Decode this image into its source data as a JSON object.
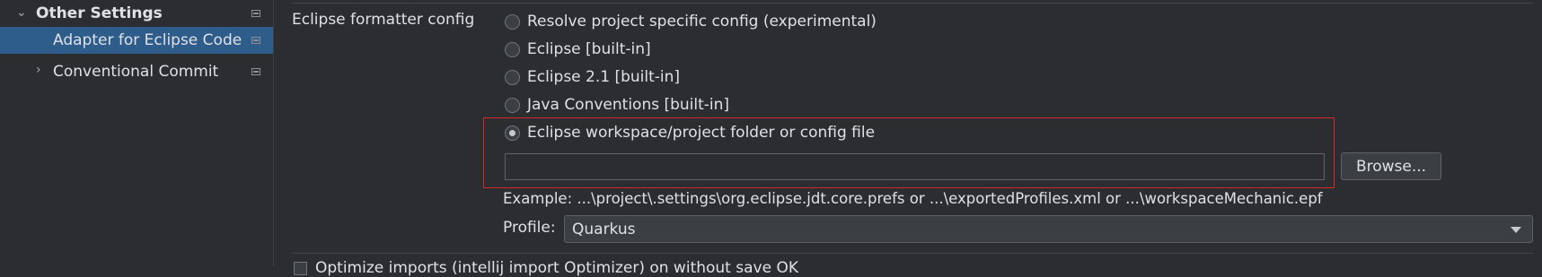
{
  "sidebar": {
    "items": [
      {
        "label": "Other Settings",
        "expanded": true
      },
      {
        "label": "Adapter for Eclipse Code Formatter",
        "selected": true
      },
      {
        "label": "Conventional Commit",
        "expanded": false
      }
    ]
  },
  "formatter": {
    "section_label": "Eclipse formatter config",
    "options": [
      {
        "label": "Resolve project specific config (experimental)",
        "checked": false
      },
      {
        "label": "Eclipse [built-in]",
        "checked": false
      },
      {
        "label": "Eclipse 2.1 [built-in]",
        "checked": false
      },
      {
        "label": "Java Conventions [built-in]",
        "checked": false
      },
      {
        "label": "Eclipse workspace/project folder or config file",
        "checked": true
      }
    ],
    "path_value": "",
    "browse_label": "Browse...",
    "example": "Example: ...\\project\\.settings\\org.eclipse.jdt.core.prefs or ...\\exportedProfiles.xml or ...\\workspaceMechanic.epf",
    "profile_label": "Profile:",
    "profile_value": "Quarkus",
    "optimize_imports_label": "Optimize imports (intellij import Optimizer) on without save OK"
  },
  "colors": {
    "background": "#2b2d30",
    "selection": "#2e5d8c",
    "highlight_border": "#d02a2a"
  }
}
